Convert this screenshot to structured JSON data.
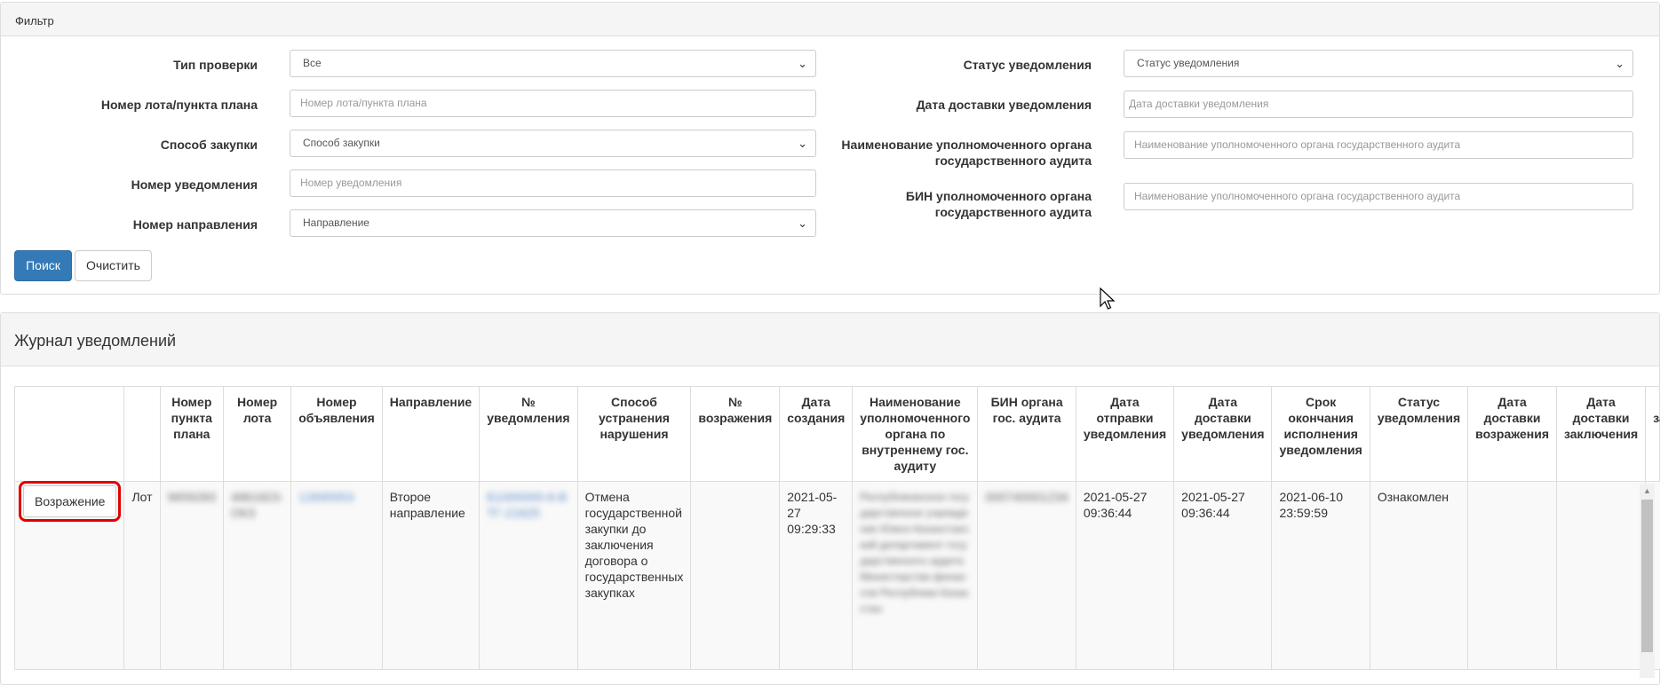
{
  "filter": {
    "title": "Фильтр",
    "left_fields": [
      {
        "label": "Тип проверки",
        "kind": "select",
        "value": "Все"
      },
      {
        "label": "Номер лота/пункта плана",
        "kind": "input",
        "placeholder": "Номер лота/пункта плана"
      },
      {
        "label": "Способ закупки",
        "kind": "select",
        "value": "Способ закупки"
      },
      {
        "label": "Номер уведомления",
        "kind": "input",
        "placeholder": "Номер уведомления"
      },
      {
        "label": "Номер направления",
        "kind": "select",
        "value": "Направление"
      }
    ],
    "right_fields": [
      {
        "label": "Статус уведомления",
        "kind": "select",
        "value": "Статус уведомления"
      },
      {
        "label": "Дата доставки уведомления",
        "kind": "input",
        "placeholder": "Дата доставки уведомления"
      },
      {
        "label_line1": "Наименование уполномоченного органа",
        "label_line2": "государственного аудита",
        "kind": "input",
        "placeholder": "Наименование уполномоченного органа государственного аудита"
      },
      {
        "label_line1": "БИН уполномоченного органа",
        "label_line2": "государственного аудита",
        "kind": "input",
        "placeholder": "Наименование уполномоченного органа государственного аудита"
      }
    ],
    "search_label": "Поиск",
    "clear_label": "Очистить"
  },
  "journal": {
    "title": "Журнал уведомлений",
    "columns": [
      "",
      "",
      "Номер пункта плана",
      "Номер лота",
      "Номер объявления",
      "Направление",
      "№ уведомления",
      "Способ устранения нарушения",
      "№ возражения",
      "Дата создания",
      "Наименование уполномоченного органа по внутреннему гос. аудиту",
      "БИН органа гос. аудита",
      "Дата отправки уведомления",
      "Дата доставки уведомления",
      "Срок окончания исполнения уведомления",
      "Статус уведомления",
      "Дата доставки возражения",
      "Дата доставки заключения",
      "Статус заключения"
    ],
    "row": {
      "objection_button": "Возражение",
      "type": "Лот",
      "plan_number": "9659283",
      "lot_number": "4861823-ОКЗ",
      "announcement_number": "12695953",
      "direction": "Второе направление",
      "notification_number": "Б1000000-6-ВТГ-21625",
      "violation_fix": "Отмена государственной закупки до заключения договора о государственных закупках",
      "objection_number": "",
      "created": "2021-05-27 09:29:33",
      "authority_name": "Республиканское государственное учреждение Южно-Казахстанский департамент государственного аудита Министерства финансов Республики Казахстан",
      "authority_bin": "000740001234",
      "sent": "2021-05-27 09:36:44",
      "delivered": "2021-05-27 09:36:44",
      "deadline": "2021-06-10 23:59:59",
      "status": "Ознакомлен",
      "objection_delivered": "",
      "conclusion_delivered": "",
      "conclusion_status": ""
    }
  }
}
